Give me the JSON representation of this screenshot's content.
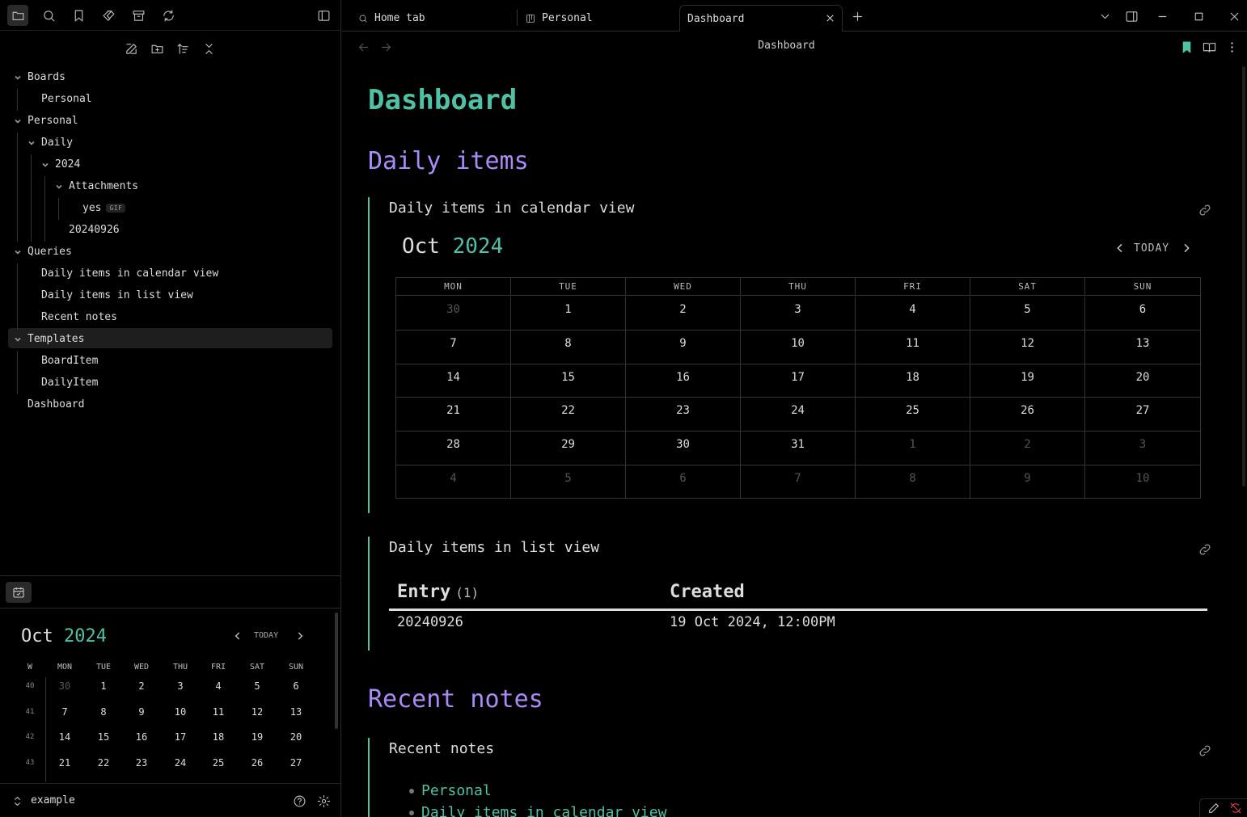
{
  "sidebar": {
    "toolbar_icons": [
      "folder-icon",
      "search-icon",
      "bookmark-icon",
      "tags-icon",
      "archive-icon",
      "sync-icon"
    ],
    "tree": [
      {
        "label": "Boards",
        "level": 0,
        "folder": true
      },
      {
        "label": "Personal",
        "level": 1,
        "folder": false
      },
      {
        "label": "Personal",
        "level": 0,
        "folder": true
      },
      {
        "label": "Daily",
        "level": 1,
        "folder": true
      },
      {
        "label": "2024",
        "level": 2,
        "folder": true
      },
      {
        "label": "Attachments",
        "level": 3,
        "folder": true
      },
      {
        "label": "yes",
        "level": 4,
        "folder": false,
        "badge": "GIF"
      },
      {
        "label": "20240926",
        "level": 3,
        "folder": false
      },
      {
        "label": "Queries",
        "level": 0,
        "folder": true
      },
      {
        "label": "Daily items in calendar view",
        "level": 1,
        "folder": false
      },
      {
        "label": "Daily items in list view",
        "level": 1,
        "folder": false
      },
      {
        "label": "Recent notes",
        "level": 1,
        "folder": false
      },
      {
        "label": "Templates",
        "level": 0,
        "folder": true
      },
      {
        "label": "BoardItem",
        "level": 1,
        "folder": false
      },
      {
        "label": "DailyItem",
        "level": 1,
        "folder": false
      },
      {
        "label": "Dashboard",
        "level": 0,
        "folder": false,
        "selected": true
      }
    ],
    "mini_calendar": {
      "month": "Oct",
      "year": "2024",
      "today_label": "TODAY",
      "week_label": "W",
      "dow": [
        "MON",
        "TUE",
        "WED",
        "THU",
        "FRI",
        "SAT",
        "SUN"
      ],
      "weeks": [
        {
          "wk": "40",
          "days": [
            "30",
            "1",
            "2",
            "3",
            "4",
            "5",
            "6"
          ]
        },
        {
          "wk": "41",
          "days": [
            "7",
            "8",
            "9",
            "10",
            "11",
            "12",
            "13"
          ]
        },
        {
          "wk": "42",
          "days": [
            "14",
            "15",
            "16",
            "17",
            "18",
            "19",
            "20"
          ]
        },
        {
          "wk": "43",
          "days": [
            "21",
            "22",
            "23",
            "24",
            "25",
            "26",
            "27"
          ]
        }
      ],
      "today_day": "24"
    },
    "vault_name": "example"
  },
  "tabs": [
    {
      "label": "Home tab",
      "icon": "search-icon"
    },
    {
      "label": "Personal",
      "icon": "board-icon"
    },
    {
      "label": "Dashboard",
      "active": true
    }
  ],
  "note": {
    "nav_title": "Dashboard",
    "title": "Dashboard",
    "sections": {
      "daily": "Daily items",
      "recent": "Recent notes"
    },
    "calendar_block": {
      "title": "Daily items in calendar view",
      "month": "Oct",
      "year": "2024",
      "today_label": "TODAY",
      "dow": [
        "MON",
        "TUE",
        "WED",
        "THU",
        "FRI",
        "SAT",
        "SUN"
      ],
      "weeks": [
        [
          "30",
          "1",
          "2",
          "3",
          "4",
          "5",
          "6"
        ],
        [
          "7",
          "8",
          "9",
          "10",
          "11",
          "12",
          "13"
        ],
        [
          "14",
          "15",
          "16",
          "17",
          "18",
          "19",
          "20"
        ],
        [
          "21",
          "22",
          "23",
          "24",
          "25",
          "26",
          "27"
        ],
        [
          "28",
          "29",
          "30",
          "31",
          "1",
          "2",
          "3"
        ],
        [
          "4",
          "5",
          "6",
          "7",
          "8",
          "9",
          "10"
        ]
      ],
      "today_day": "24"
    },
    "list_block": {
      "title": "Daily items in list view",
      "col_entry": "Entry",
      "col_entry_count": "(1)",
      "col_created": "Created",
      "rows": [
        {
          "entry": "20240926",
          "created": "19 Oct 2024, 12:00PM"
        }
      ]
    },
    "recent_block": {
      "title": "Recent notes",
      "items": [
        "Personal",
        "Daily items in calendar view"
      ]
    }
  },
  "colors": {
    "accent": "#4fc1a5",
    "heading": "#a98bf7"
  }
}
